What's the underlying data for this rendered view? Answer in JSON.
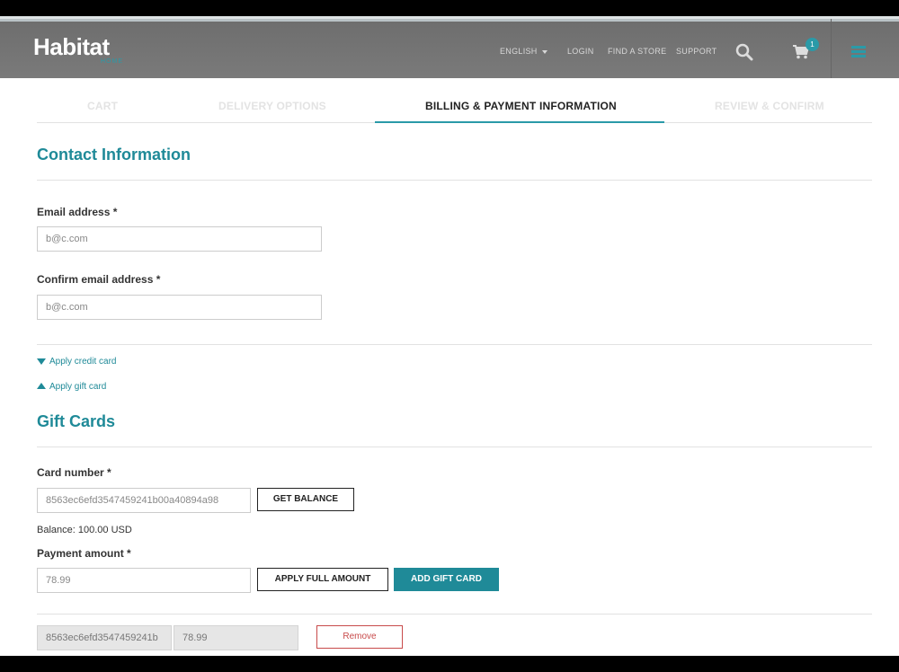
{
  "header": {
    "logo": "Habitat",
    "logo_sub": "HOME",
    "language": "ENGLISH",
    "login": "LOGIN",
    "find_store": "FIND A STORE",
    "support": "SUPPORT",
    "cart_count": "1"
  },
  "steps": [
    "CART",
    "DELIVERY OPTIONS",
    "BILLING & PAYMENT INFORMATION",
    "REVIEW & CONFIRM"
  ],
  "contact": {
    "title": "Contact Information",
    "email_label": "Email address *",
    "email_value": "b@c.com",
    "confirm_label": "Confirm email address *",
    "confirm_value": "b@c.com"
  },
  "toggles": {
    "credit_card": "Apply credit card",
    "gift_card": "Apply gift card"
  },
  "gift": {
    "title": "Gift Cards",
    "card_label": "Card number *",
    "card_value": "8563ec6efd3547459241b00a40894a98",
    "get_balance": "GET BALANCE",
    "balance": "Balance: 100.00 USD",
    "amount_label": "Payment amount *",
    "amount_value": "78.99",
    "apply_full": "APPLY FULL AMOUNT",
    "add_card": "ADD GIFT CARD",
    "applied_card": "8563ec6efd3547459241b",
    "applied_amount": "78.99",
    "remove": "Remove"
  },
  "colors": {
    "accent": "#1f8a98",
    "header_bg": "#757575",
    "remove": "#c84a4a"
  }
}
